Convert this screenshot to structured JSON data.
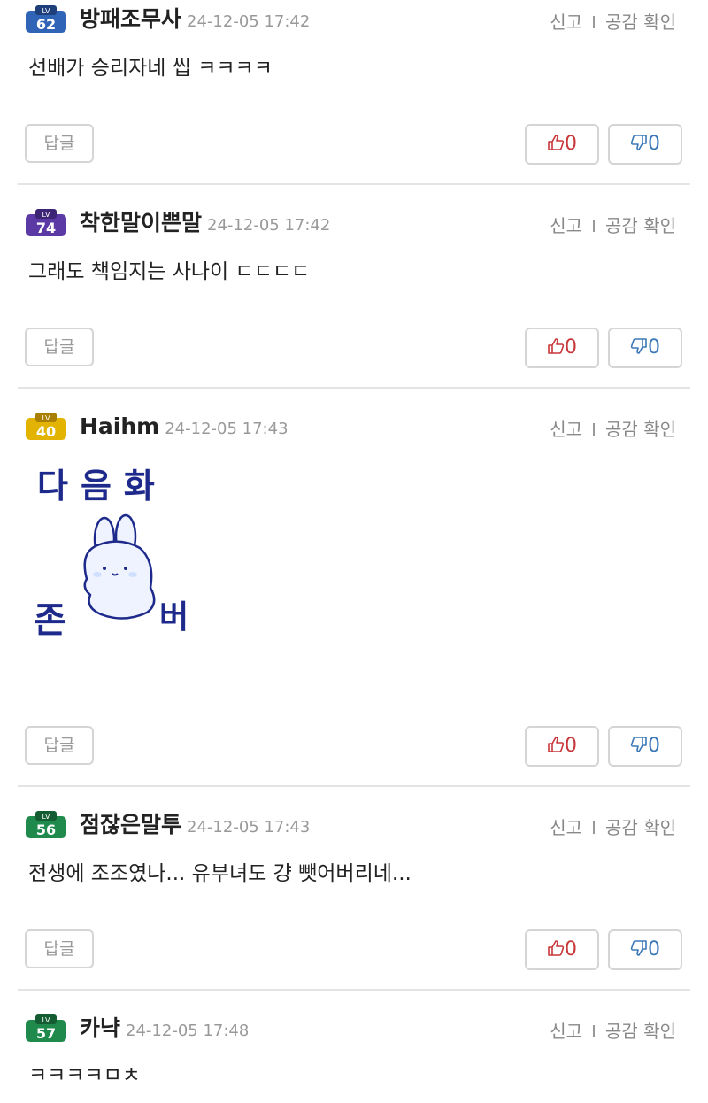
{
  "actions": {
    "report_label": "신고",
    "sympathy_label": "공감 확인"
  },
  "reply_label": "답글",
  "comments": [
    {
      "level": "62",
      "badge_color": "#2f64b7",
      "nickname": "방패조무사",
      "timestamp": "24-12-05 17:42",
      "text": "선배가 승리자네 씹 ㅋㅋㅋㅋ",
      "likes": "0",
      "dislikes": "0"
    },
    {
      "level": "74",
      "badge_color": "#5b3aa6",
      "nickname": "착한말이쁜말",
      "timestamp": "24-12-05 17:42",
      "text": "그래도 책임지는 사나이 ㄷㄷㄷㄷ",
      "likes": "0",
      "dislikes": "0"
    },
    {
      "level": "40",
      "badge_color": "#e2b300",
      "nickname": "Haihm",
      "timestamp": "24-12-05 17:43",
      "sticker": {
        "top_text": "다음화",
        "left_text": "존",
        "right_text": "버"
      },
      "likes": "0",
      "dislikes": "0"
    },
    {
      "level": "56",
      "badge_color": "#1f8a4c",
      "nickname": "점잖은말투",
      "timestamp": "24-12-05 17:43",
      "text": "전생에 조조였나... 유부녀도 걍 뺏어버리네...",
      "likes": "0",
      "dislikes": "0"
    },
    {
      "level": "57",
      "badge_color": "#1f8a4c",
      "nickname": "카냑",
      "timestamp": "24-12-05 17:48",
      "text": "ㅋㅋㅋㅋㅁㅊ"
    }
  ]
}
